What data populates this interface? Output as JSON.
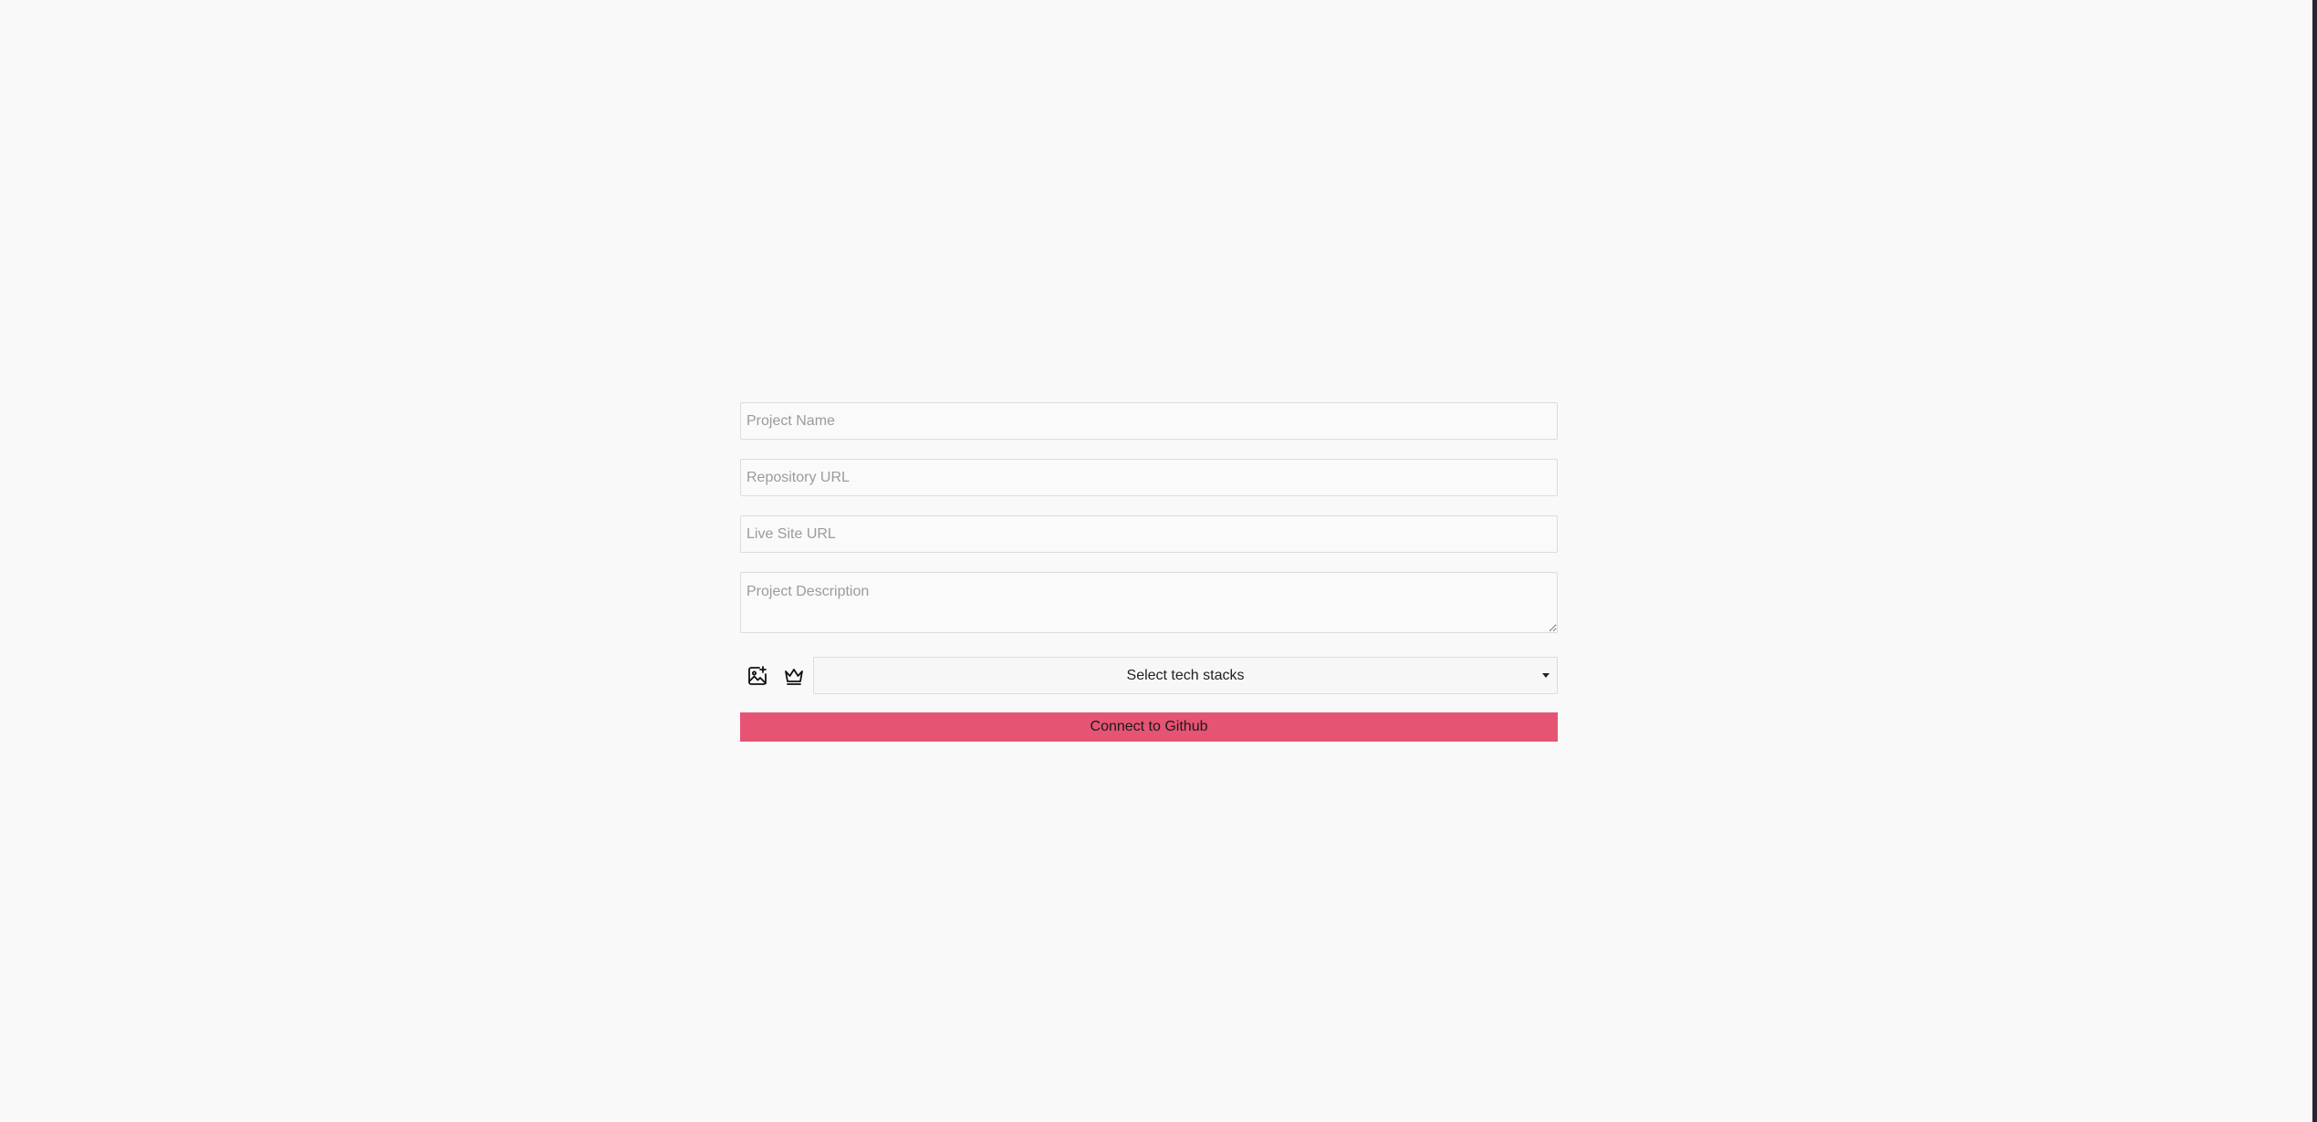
{
  "form": {
    "project_name_placeholder": "Project Name",
    "repository_url_placeholder": "Repository URL",
    "live_site_url_placeholder": "Live Site URL",
    "project_description_placeholder": "Project Description"
  },
  "toolbar": {
    "image_icon": "add-image-icon",
    "crown_icon": "crown-icon",
    "tech_stack_select_label": "Select tech stacks"
  },
  "submit": {
    "label": "Connect to Github"
  },
  "colors": {
    "background": "#f9f9f9",
    "accent": "#e65474",
    "border": "#dcdcdc"
  }
}
